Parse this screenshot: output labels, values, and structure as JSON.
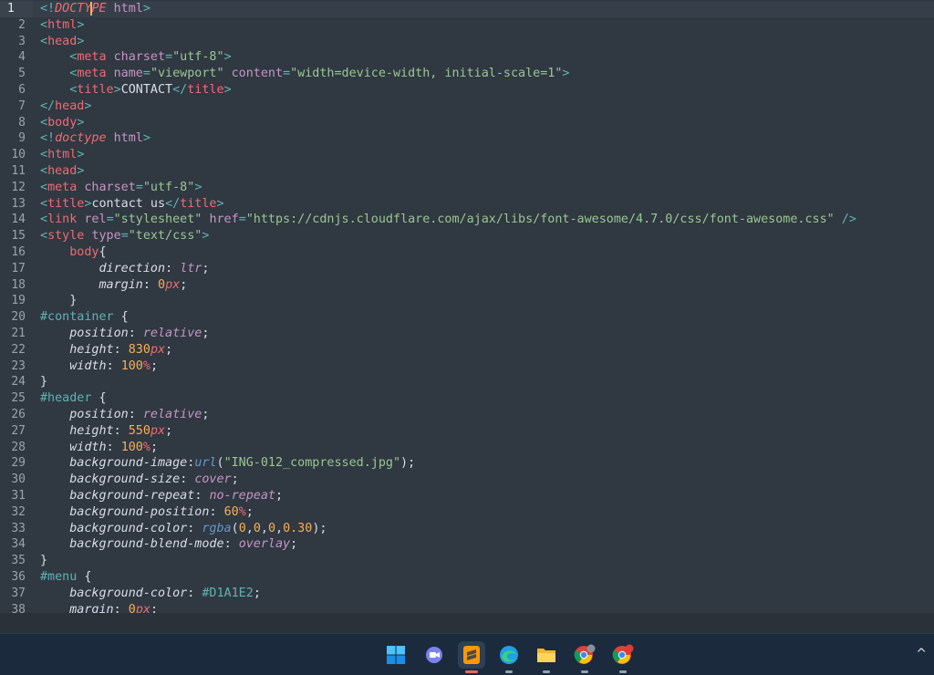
{
  "editor": {
    "cursor_line": 1,
    "lines": [
      [
        [
          "t-punc",
          "<!"
        ],
        [
          "t-kw",
          "DOCTY"
        ],
        [
          "caret",
          ""
        ],
        [
          "t-kw",
          "PE"
        ],
        [
          "t-text",
          " "
        ],
        [
          "t-attr",
          "html"
        ],
        [
          "t-punc",
          ">"
        ]
      ],
      [
        [
          "t-punc",
          "<"
        ],
        [
          "t-tag",
          "html"
        ],
        [
          "t-punc",
          ">"
        ]
      ],
      [
        [
          "t-punc",
          "<"
        ],
        [
          "t-tag",
          "head"
        ],
        [
          "t-punc",
          ">"
        ]
      ],
      [
        [
          "t-text",
          "    "
        ],
        [
          "t-punc",
          "<"
        ],
        [
          "t-tag",
          "meta"
        ],
        [
          "t-text",
          " "
        ],
        [
          "t-attr",
          "charset"
        ],
        [
          "t-punc",
          "="
        ],
        [
          "t-str",
          "\"utf-8\""
        ],
        [
          "t-punc",
          ">"
        ]
      ],
      [
        [
          "t-text",
          "    "
        ],
        [
          "t-punc",
          "<"
        ],
        [
          "t-tag",
          "meta"
        ],
        [
          "t-text",
          " "
        ],
        [
          "t-attr",
          "name"
        ],
        [
          "t-punc",
          "="
        ],
        [
          "t-str",
          "\"viewport\""
        ],
        [
          "t-text",
          " "
        ],
        [
          "t-attr",
          "content"
        ],
        [
          "t-punc",
          "="
        ],
        [
          "t-str",
          "\"width=device-width, initial-scale=1\""
        ],
        [
          "t-punc",
          ">"
        ]
      ],
      [
        [
          "t-text",
          "    "
        ],
        [
          "t-punc",
          "<"
        ],
        [
          "t-tag",
          "title"
        ],
        [
          "t-punc",
          ">"
        ],
        [
          "t-text",
          "CONTACT"
        ],
        [
          "t-punc",
          "</"
        ],
        [
          "t-tag",
          "title"
        ],
        [
          "t-punc",
          ">"
        ]
      ],
      [
        [
          "t-punc",
          "</"
        ],
        [
          "t-tag",
          "head"
        ],
        [
          "t-punc",
          ">"
        ]
      ],
      [
        [
          "t-punc",
          "<"
        ],
        [
          "t-tag",
          "body"
        ],
        [
          "t-punc",
          ">"
        ]
      ],
      [
        [
          "t-punc",
          "<!"
        ],
        [
          "t-kw",
          "doctype"
        ],
        [
          "t-text",
          " "
        ],
        [
          "t-attr",
          "html"
        ],
        [
          "t-punc",
          ">"
        ]
      ],
      [
        [
          "t-punc",
          "<"
        ],
        [
          "t-tag",
          "html"
        ],
        [
          "t-punc",
          ">"
        ]
      ],
      [
        [
          "t-punc",
          "<"
        ],
        [
          "t-tag",
          "head"
        ],
        [
          "t-punc",
          ">"
        ]
      ],
      [
        [
          "t-punc",
          "<"
        ],
        [
          "t-tag",
          "meta"
        ],
        [
          "t-text",
          " "
        ],
        [
          "t-attr",
          "charset"
        ],
        [
          "t-punc",
          "="
        ],
        [
          "t-str",
          "\"utf-8\""
        ],
        [
          "t-punc",
          ">"
        ]
      ],
      [
        [
          "t-punc",
          "<"
        ],
        [
          "t-tag",
          "title"
        ],
        [
          "t-punc",
          ">"
        ],
        [
          "t-text",
          "contact us"
        ],
        [
          "t-punc",
          "</"
        ],
        [
          "t-tag",
          "title"
        ],
        [
          "t-punc",
          ">"
        ]
      ],
      [
        [
          "t-punc",
          "<"
        ],
        [
          "t-tag",
          "link"
        ],
        [
          "t-text",
          " "
        ],
        [
          "t-attr",
          "rel"
        ],
        [
          "t-punc",
          "="
        ],
        [
          "t-str",
          "\"stylesheet\""
        ],
        [
          "t-text",
          " "
        ],
        [
          "t-attr",
          "href"
        ],
        [
          "t-punc",
          "="
        ],
        [
          "t-str",
          "\"https://cdnjs.cloudflare.com/ajax/libs/font-awesome/4.7.0/css/font-awesome.css\""
        ],
        [
          "t-text",
          " "
        ],
        [
          "t-punc",
          "/>"
        ]
      ],
      [
        [
          "t-punc",
          "<"
        ],
        [
          "t-tag",
          "style"
        ],
        [
          "t-text",
          " "
        ],
        [
          "t-attr",
          "type"
        ],
        [
          "t-punc",
          "="
        ],
        [
          "t-str",
          "\"text/css\""
        ],
        [
          "t-punc",
          ">"
        ]
      ],
      [
        [
          "t-text",
          "    "
        ],
        [
          "t-tag",
          "body"
        ],
        [
          "t-white",
          "{"
        ]
      ],
      [
        [
          "t-text",
          "        "
        ],
        [
          "t-prop",
          "direction"
        ],
        [
          "t-white",
          ": "
        ],
        [
          "t-val",
          "ltr"
        ],
        [
          "t-white",
          ";"
        ]
      ],
      [
        [
          "t-text",
          "        "
        ],
        [
          "t-prop",
          "margin"
        ],
        [
          "t-white",
          ": "
        ],
        [
          "t-num",
          "0"
        ],
        [
          "t-unit",
          "px"
        ],
        [
          "t-white",
          ";"
        ]
      ],
      [
        [
          "t-text",
          "    "
        ],
        [
          "t-white",
          "}"
        ]
      ],
      [
        [
          "t-sel",
          "#container"
        ],
        [
          "t-white",
          " {"
        ]
      ],
      [
        [
          "t-text",
          "    "
        ],
        [
          "t-prop",
          "position"
        ],
        [
          "t-white",
          ": "
        ],
        [
          "t-val",
          "relative"
        ],
        [
          "t-white",
          ";"
        ]
      ],
      [
        [
          "t-text",
          "    "
        ],
        [
          "t-prop",
          "height"
        ],
        [
          "t-white",
          ": "
        ],
        [
          "t-num",
          "830"
        ],
        [
          "t-unit",
          "px"
        ],
        [
          "t-white",
          ";"
        ]
      ],
      [
        [
          "t-text",
          "    "
        ],
        [
          "t-prop",
          "width"
        ],
        [
          "t-white",
          ": "
        ],
        [
          "t-num",
          "100"
        ],
        [
          "t-unit",
          "%"
        ],
        [
          "t-white",
          ";"
        ]
      ],
      [
        [
          "t-white",
          "}"
        ]
      ],
      [
        [
          "t-sel",
          "#header"
        ],
        [
          "t-white",
          " {"
        ]
      ],
      [
        [
          "t-text",
          "    "
        ],
        [
          "t-prop",
          "position"
        ],
        [
          "t-white",
          ": "
        ],
        [
          "t-val",
          "relative"
        ],
        [
          "t-white",
          ";"
        ]
      ],
      [
        [
          "t-text",
          "    "
        ],
        [
          "t-prop",
          "height"
        ],
        [
          "t-white",
          ": "
        ],
        [
          "t-num",
          "550"
        ],
        [
          "t-unit",
          "px"
        ],
        [
          "t-white",
          ";"
        ]
      ],
      [
        [
          "t-text",
          "    "
        ],
        [
          "t-prop",
          "width"
        ],
        [
          "t-white",
          ": "
        ],
        [
          "t-num",
          "100"
        ],
        [
          "t-unit",
          "%"
        ],
        [
          "t-white",
          ";"
        ]
      ],
      [
        [
          "t-text",
          "    "
        ],
        [
          "t-prop",
          "background-image"
        ],
        [
          "t-white",
          ":"
        ],
        [
          "t-fn",
          "url"
        ],
        [
          "t-white",
          "("
        ],
        [
          "t-str",
          "\"ING-012_compressed.jpg\""
        ],
        [
          "t-white",
          ");"
        ]
      ],
      [
        [
          "t-text",
          "    "
        ],
        [
          "t-prop",
          "background-size"
        ],
        [
          "t-white",
          ": "
        ],
        [
          "t-val",
          "cover"
        ],
        [
          "t-white",
          ";"
        ]
      ],
      [
        [
          "t-text",
          "    "
        ],
        [
          "t-prop",
          "background-repeat"
        ],
        [
          "t-white",
          ": "
        ],
        [
          "t-val",
          "no-repeat"
        ],
        [
          "t-white",
          ";"
        ]
      ],
      [
        [
          "t-text",
          "    "
        ],
        [
          "t-prop",
          "background-position"
        ],
        [
          "t-white",
          ": "
        ],
        [
          "t-num",
          "60"
        ],
        [
          "t-unit",
          "%"
        ],
        [
          "t-white",
          ";"
        ]
      ],
      [
        [
          "t-text",
          "    "
        ],
        [
          "t-prop",
          "background-color"
        ],
        [
          "t-white",
          ": "
        ],
        [
          "t-fn",
          "rgba"
        ],
        [
          "t-white",
          "("
        ],
        [
          "t-num",
          "0"
        ],
        [
          "t-white",
          ","
        ],
        [
          "t-num",
          "0"
        ],
        [
          "t-white",
          ","
        ],
        [
          "t-num",
          "0"
        ],
        [
          "t-white",
          ","
        ],
        [
          "t-num",
          "0.30"
        ],
        [
          "t-white",
          ");"
        ]
      ],
      [
        [
          "t-text",
          "    "
        ],
        [
          "t-prop",
          "background-blend-mode"
        ],
        [
          "t-white",
          ": "
        ],
        [
          "t-val",
          "overlay"
        ],
        [
          "t-white",
          ";"
        ]
      ],
      [
        [
          "t-white",
          "}"
        ]
      ],
      [
        [
          "t-sel",
          "#menu"
        ],
        [
          "t-white",
          " {"
        ]
      ],
      [
        [
          "t-text",
          "    "
        ],
        [
          "t-prop",
          "background-color"
        ],
        [
          "t-white",
          ": "
        ],
        [
          "t-sel",
          "#D1A1E2"
        ],
        [
          "t-white",
          ";"
        ]
      ],
      [
        [
          "t-text",
          "    "
        ],
        [
          "t-prop",
          "margin"
        ],
        [
          "t-white",
          ": "
        ],
        [
          "t-num",
          "0"
        ],
        [
          "t-unit",
          "px"
        ],
        [
          "t-white",
          ";"
        ]
      ]
    ]
  },
  "taskbar": {
    "apps": [
      {
        "name": "start-icon"
      },
      {
        "name": "teams-chat-icon"
      },
      {
        "name": "sublime-text-icon",
        "active": true
      },
      {
        "name": "edge-icon"
      },
      {
        "name": "file-explorer-icon"
      },
      {
        "name": "chrome-profile-icon"
      },
      {
        "name": "chrome-icon"
      }
    ],
    "tray_chevron": "^"
  }
}
